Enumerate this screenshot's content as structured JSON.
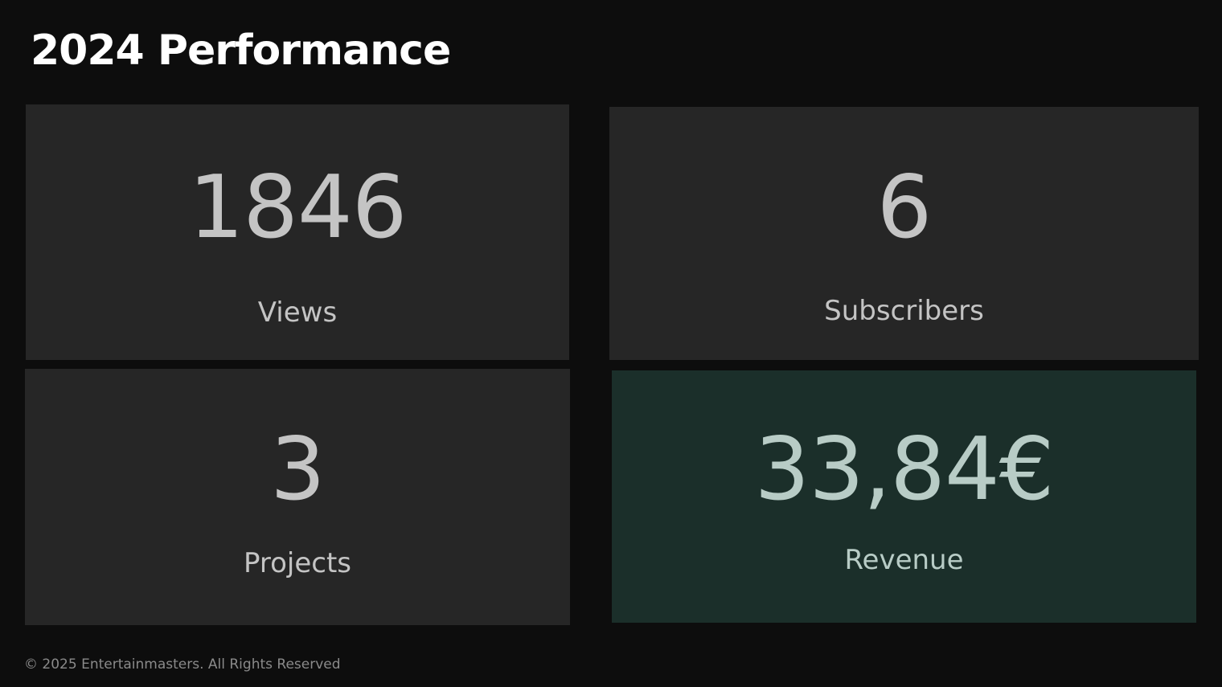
{
  "header": {
    "title": "2024 Performance"
  },
  "stats": {
    "views": {
      "value": "1846",
      "label": "Views"
    },
    "subscribers": {
      "value": "6",
      "label": "Subscribers"
    },
    "projects": {
      "value": "3",
      "label": "Projects"
    },
    "revenue": {
      "value": "33,84€",
      "label": "Revenue"
    }
  },
  "footer": {
    "copyright": "© 2025 Entertainmasters. All Rights Reserved"
  },
  "colors": {
    "background": "#0d0d0d",
    "card": "#262626",
    "revenue_card": "#1b2f2a",
    "text_primary": "#ffffff",
    "text_stat": "#c4c4c4",
    "text_revenue": "#b8ccc6"
  }
}
